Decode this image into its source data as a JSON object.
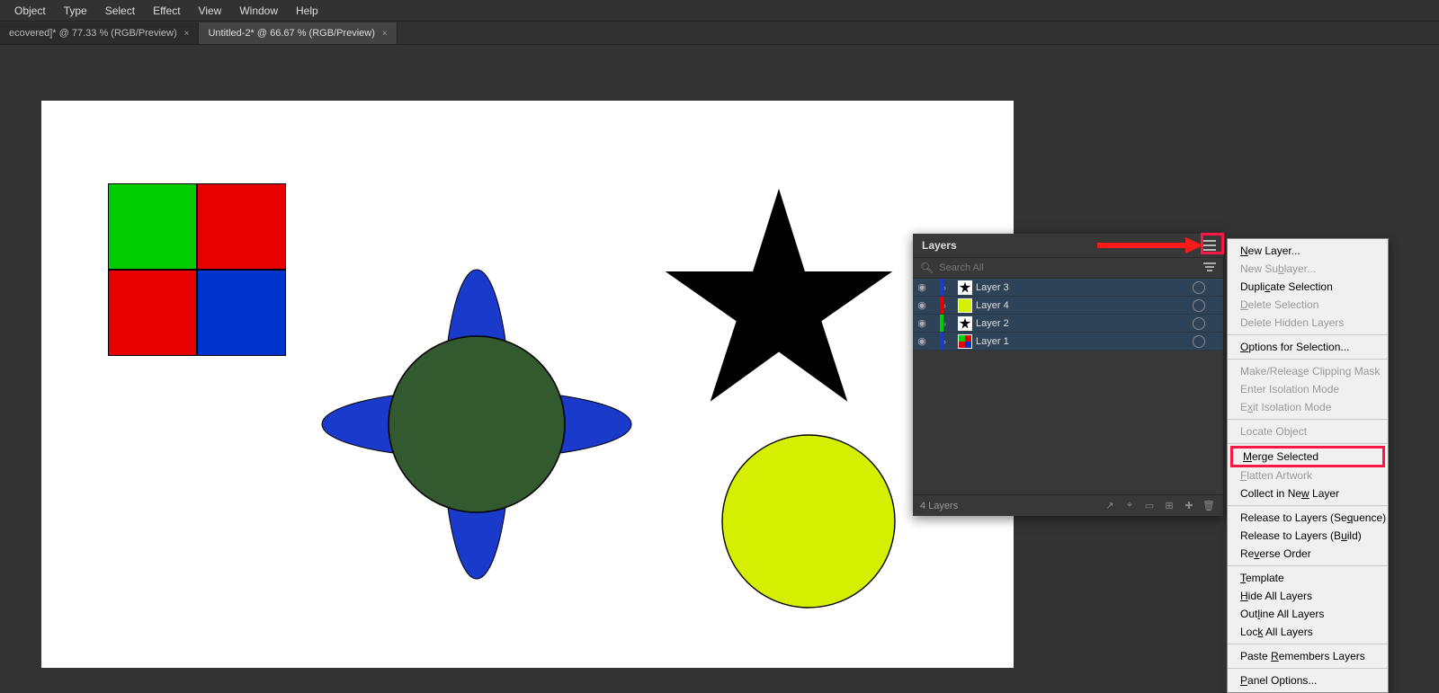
{
  "menubar": [
    "Object",
    "Type",
    "Select",
    "Effect",
    "View",
    "Window",
    "Help"
  ],
  "tabs": [
    {
      "label": "ecovered]* @ 77.33 % (RGB/Preview)",
      "active": false
    },
    {
      "label": "Untitled-2* @ 66.67 % (RGB/Preview)",
      "active": true
    }
  ],
  "canvas": {
    "shapes": {
      "square_colors": [
        "#00cc00",
        "#e60000",
        "#e60000",
        "#0033cc"
      ],
      "star_color": "#000000",
      "cross_color": "#1a3acc",
      "center_circle_color": "#33592f",
      "lime_circle_color": "#d4f000"
    }
  },
  "layersPanel": {
    "title": "Layers",
    "search_placeholder": "Search All",
    "rows": [
      {
        "name": "Layer 3",
        "color": "#1a3acc",
        "thumb": "star"
      },
      {
        "name": "Layer 4",
        "color": "#e60000",
        "thumb": "lime"
      },
      {
        "name": "Layer 2",
        "color": "#00cc00",
        "thumb": "star"
      },
      {
        "name": "Layer 1",
        "color": "#1a3acc",
        "thumb": "quad"
      }
    ],
    "footer_label": "4 Layers"
  },
  "flyout": {
    "items": [
      {
        "type": "item",
        "label": "New Layer...",
        "u": "N"
      },
      {
        "type": "item",
        "label": "New Sublayer...",
        "u": "b",
        "disabled": true
      },
      {
        "type": "item",
        "label": "Duplicate Selection",
        "u": "c"
      },
      {
        "type": "item",
        "label": "Delete Selection",
        "u": "D",
        "disabled": true
      },
      {
        "type": "item",
        "label": "Delete Hidden Layers",
        "disabled": true
      },
      {
        "type": "sep"
      },
      {
        "type": "item",
        "label": "Options for Selection...",
        "u": "O"
      },
      {
        "type": "sep"
      },
      {
        "type": "item",
        "label": "Make/Release Clipping Mask",
        "u": "s",
        "disabled": true
      },
      {
        "type": "item",
        "label": "Enter Isolation Mode",
        "disabled": true
      },
      {
        "type": "item",
        "label": "Exit Isolation Mode",
        "u": "x",
        "disabled": true
      },
      {
        "type": "sep"
      },
      {
        "type": "item",
        "label": "Locate Object",
        "u": "j",
        "disabled": true
      },
      {
        "type": "sep"
      },
      {
        "type": "item",
        "label": "Merge Selected",
        "u": "M",
        "highlight": true
      },
      {
        "type": "item",
        "label": "Flatten Artwork",
        "u": "F",
        "disabled": true
      },
      {
        "type": "item",
        "label": "Collect in New Layer",
        "u": "w"
      },
      {
        "type": "sep"
      },
      {
        "type": "item",
        "label": "Release to Layers (Sequence)",
        "u": "q"
      },
      {
        "type": "item",
        "label": "Release to Layers (Build)",
        "u": "u"
      },
      {
        "type": "item",
        "label": "Reverse Order",
        "u": "v"
      },
      {
        "type": "sep"
      },
      {
        "type": "item",
        "label": "Template",
        "u": "T"
      },
      {
        "type": "item",
        "label": "Hide All Layers",
        "u": "H"
      },
      {
        "type": "item",
        "label": "Outline All Layers",
        "u": "l"
      },
      {
        "type": "item",
        "label": "Lock All Layers",
        "u": "k"
      },
      {
        "type": "sep"
      },
      {
        "type": "item",
        "label": "Paste Remembers Layers",
        "u": "R"
      },
      {
        "type": "sep"
      },
      {
        "type": "item",
        "label": "Panel Options...",
        "u": "P"
      }
    ]
  }
}
